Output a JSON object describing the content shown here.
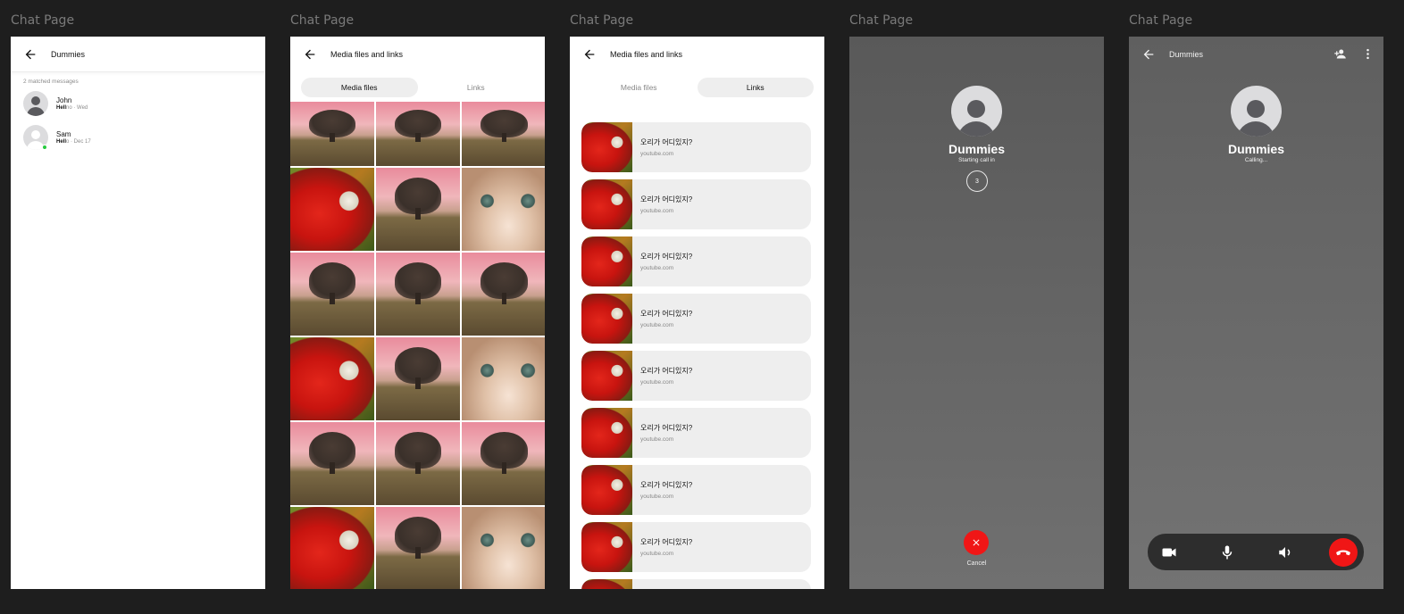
{
  "frame_label": "Chat Page",
  "screen1": {
    "title": "Dummies",
    "match_count": "2 matched messages",
    "results": [
      {
        "name": "John",
        "highlight": "Hell",
        "rest": "no · Wed"
      },
      {
        "name": "Sam",
        "highlight": "Hell",
        "rest": "o · Dec 17"
      }
    ]
  },
  "screen2": {
    "title": "Media files and links",
    "tabs": [
      "Media files",
      "Links"
    ],
    "active_tab": "Media files"
  },
  "screen3": {
    "title": "Media files and links",
    "tabs": [
      "Media files",
      "Links"
    ],
    "active_tab": "Links",
    "links": [
      {
        "title": "오리가 어디있지?",
        "domain": "youtube.com"
      },
      {
        "title": "오리가 어디있지?",
        "domain": "youtube.com"
      },
      {
        "title": "오리가 어디있지?",
        "domain": "youtube.com"
      },
      {
        "title": "오리가 어디있지?",
        "domain": "youtube.com"
      },
      {
        "title": "오리가 어디있지?",
        "domain": "youtube.com"
      },
      {
        "title": "오리가 어디있지?",
        "domain": "youtube.com"
      },
      {
        "title": "오리가 어디있지?",
        "domain": "youtube.com"
      },
      {
        "title": "오리가 어디있지?",
        "domain": "youtube.com"
      }
    ]
  },
  "screen4": {
    "name": "Dummies",
    "status": "Starting call in",
    "countdown": "3",
    "cancel_label": "Cancel",
    "cancel_color": "#f01616"
  },
  "screen5": {
    "title": "Dummies",
    "name": "Dummies",
    "status": "Calling...",
    "controls": [
      "video-icon",
      "microphone-icon",
      "speaker-icon",
      "end-call-icon"
    ],
    "end_color": "#f01616"
  },
  "colors": {
    "background": "#1e1e1e",
    "online": "#27c93f",
    "danger": "#f01616"
  }
}
